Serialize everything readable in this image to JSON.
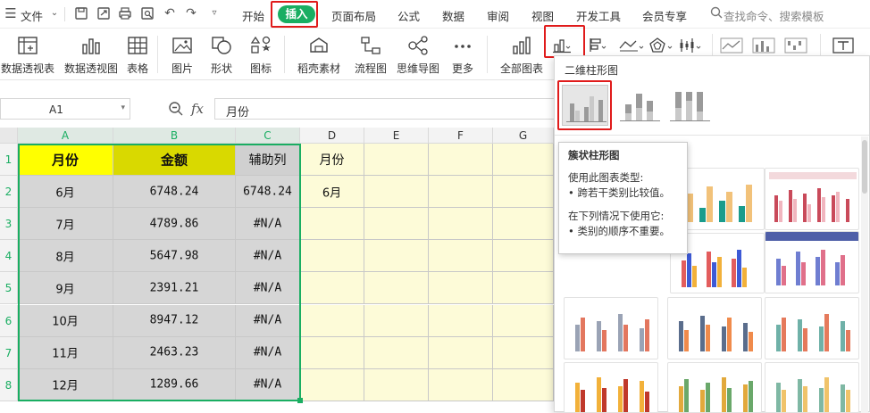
{
  "menubar": {
    "file_label": "文件",
    "tabs": [
      "开始",
      "插入",
      "页面布局",
      "公式",
      "数据",
      "审阅",
      "视图",
      "开发工具",
      "会员专享"
    ],
    "search_placeholder": "查找命令、搜索模板"
  },
  "ribbon": {
    "buttons": [
      "数据透视表",
      "数据透视图",
      "表格",
      "图片",
      "形状",
      "图标",
      "稻壳素材",
      "流程图",
      "思维导图",
      "更多",
      "全部图表"
    ]
  },
  "formula_bar": {
    "cell_ref": "A1",
    "fx_label": "fx",
    "value": "月份"
  },
  "sheet": {
    "columns": [
      "A",
      "B",
      "C",
      "D",
      "E",
      "F",
      "G"
    ],
    "rows": [
      "1",
      "2",
      "3",
      "4",
      "5",
      "6",
      "7",
      "8"
    ],
    "headers": [
      "月份",
      "金额",
      "辅助列",
      "月份"
    ],
    "data": [
      [
        "6月",
        "6748.24",
        "6748.24",
        "6月"
      ],
      [
        "7月",
        "4789.86",
        "#N/A",
        ""
      ],
      [
        "8月",
        "5647.98",
        "#N/A",
        ""
      ],
      [
        "9月",
        "2391.21",
        "#N/A",
        ""
      ],
      [
        "10月",
        "8947.12",
        "#N/A",
        ""
      ],
      [
        "11月",
        "2463.23",
        "#N/A",
        ""
      ],
      [
        "12月",
        "1289.66",
        "#N/A",
        ""
      ]
    ]
  },
  "chart_panel": {
    "title": "二维柱形图",
    "tooltip": {
      "title": "簇状柱形图",
      "line1": "使用此图表类型:",
      "line2": "• 跨若干类别比较值。",
      "line3": "在下列情况下使用它:",
      "line4": "• 类别的顺序不重要。"
    }
  },
  "colors": {
    "accent_green": "#1aae62",
    "highlight_red": "#e01b1b",
    "header_yellow": "#ffff00",
    "header_olive": "#d9d900",
    "cell_gray": "#d6d6d6",
    "sheet_bg_yellow": "#fdfbd8"
  }
}
